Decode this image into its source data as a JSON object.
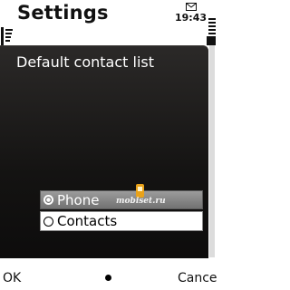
{
  "header": {
    "title": "Settings",
    "clock": "19:43"
  },
  "dialog": {
    "title": "Default contact list",
    "options": [
      {
        "label": "Phone",
        "selected": true
      },
      {
        "label": "Contacts",
        "selected": false
      }
    ]
  },
  "watermark": {
    "text": "mobiset.ru"
  },
  "softkeys": {
    "left": "OK",
    "right": "Cancel"
  },
  "icons": {
    "signal": "signal-strength-icon",
    "mail": "envelope-icon",
    "battery": "battery-icon",
    "middle": "dot-icon"
  },
  "colors": {
    "dialog_bg": "#141312",
    "highlight": "#8a8a8a",
    "text_light": "#ffffff"
  }
}
